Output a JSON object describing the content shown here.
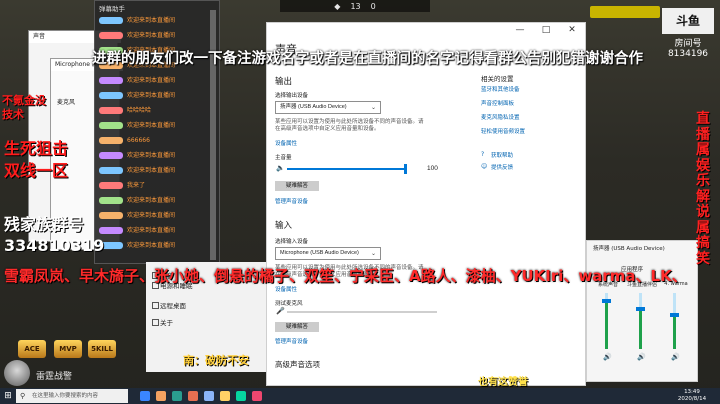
{
  "overlay": {
    "top_banner": "进群的朋友们改一下备注游戏名字或者是在直播间的名字记得看群公告别犯错谢谢合作",
    "left_tag1": "不氪金没技术",
    "left_tag2": "生死狙击双线一区",
    "group_label": "残家族群号",
    "group_number": "334810319",
    "names_marquee": "雪霸凤岚、早木旖子、张小她、倒悬的橘子、双笙、宁采臣、A路人、漆柚、YUKIri、warma、LK、",
    "right_vertical": "直播属娱乐解说属搞笑",
    "bottom_left_tip": "南：破防不安",
    "bottom_right_tip": "也有这赞誉",
    "avatar_name": "雷霆战警",
    "badges": [
      "ACE",
      "MVP",
      "5KILL"
    ],
    "brand": {
      "logo": "斗鱼",
      "sub": "房间号",
      "room_id": "8134196"
    },
    "hud": {
      "left": "◆",
      "score_a": "13",
      "score_b": "0"
    }
  },
  "chat": {
    "title": "弹幕助手",
    "messages": [
      "欢迎来到本直播间",
      "欢迎来到本直播间",
      "欢迎来到本直播间",
      "欢迎来到本直播间",
      "欢迎来到本直播间",
      "欢迎来到本直播间",
      "哈哈哈哈",
      "欢迎来到本直播间",
      "666666",
      "欢迎来到本直播间",
      "欢迎来到本直播间",
      "我来了",
      "欢迎来到本直播间",
      "欢迎来到本直播间",
      "欢迎来到本直播间",
      "欢迎来到本直播间"
    ],
    "tag_colors": [
      "#7dc6ff",
      "#ff7a7a",
      "#a2e28a",
      "#f6b26b",
      "#c58aff"
    ]
  },
  "sound_panel": {
    "title": "声音",
    "mic_title": "Microphone 属性",
    "mic_label": "麦克风"
  },
  "mini_nav": {
    "items": [
      "声音",
      "电源和睡眠",
      "远程桌面",
      "关于"
    ]
  },
  "settings": {
    "page_title": "声音",
    "output_header": "输出",
    "output_device_label": "选择输出设备",
    "output_device": "扬声器 (USB Audio Device)",
    "output_note": "某些应用可以设置为使用与此处所选设备不同的声音设备。请在高级声音选项中自定义应用音量和设备。",
    "device_props": "设备属性",
    "master_volume_label": "主音量",
    "master_volume_value": "100",
    "troubleshoot": "疑难解答",
    "manage_devices": "管理声音设备",
    "input_header": "输入",
    "input_device_label": "选择输入设备",
    "input_device": "Microphone (USB Audio Device)",
    "input_note": "某些应用可以设置为使用与此处所选设备不同的声音设备。请在高级声音选项中自定义应用音量和设备。",
    "input_props": "设备属性",
    "test_mic": "测试麦克风",
    "troubleshoot2": "疑难解答",
    "manage_devices2": "管理声音设备",
    "advanced": "高级声音选项",
    "related_header": "相关的设置",
    "related_links": [
      "蓝牙和其他设备",
      "声音控制面板",
      "麦克风隐私设置",
      "轻松使用音频设置"
    ],
    "help_links": [
      "获取帮助",
      "提供反馈"
    ],
    "win_controls": [
      "—",
      "□",
      "✕"
    ]
  },
  "mixer": {
    "device_label": "扬声器 (USB Audio Device)",
    "app_header": "应用程序",
    "channels": [
      {
        "label": "系统声音",
        "level": 0.85
      },
      {
        "label": "斗鱼直播伴侣",
        "level": 0.72
      },
      {
        "label": "4. warma",
        "level": 0.6
      }
    ]
  },
  "taskbar": {
    "search_placeholder": "在这里输入你要搜索的内容",
    "time": "13:49",
    "date": "2020/8/14",
    "icon_colors": [
      "#3a86ff",
      "#f4a261",
      "#2a9d8f",
      "#e76f51",
      "#8ab4f8",
      "#ffd166",
      "#06d6a0",
      "#ef476f"
    ]
  }
}
